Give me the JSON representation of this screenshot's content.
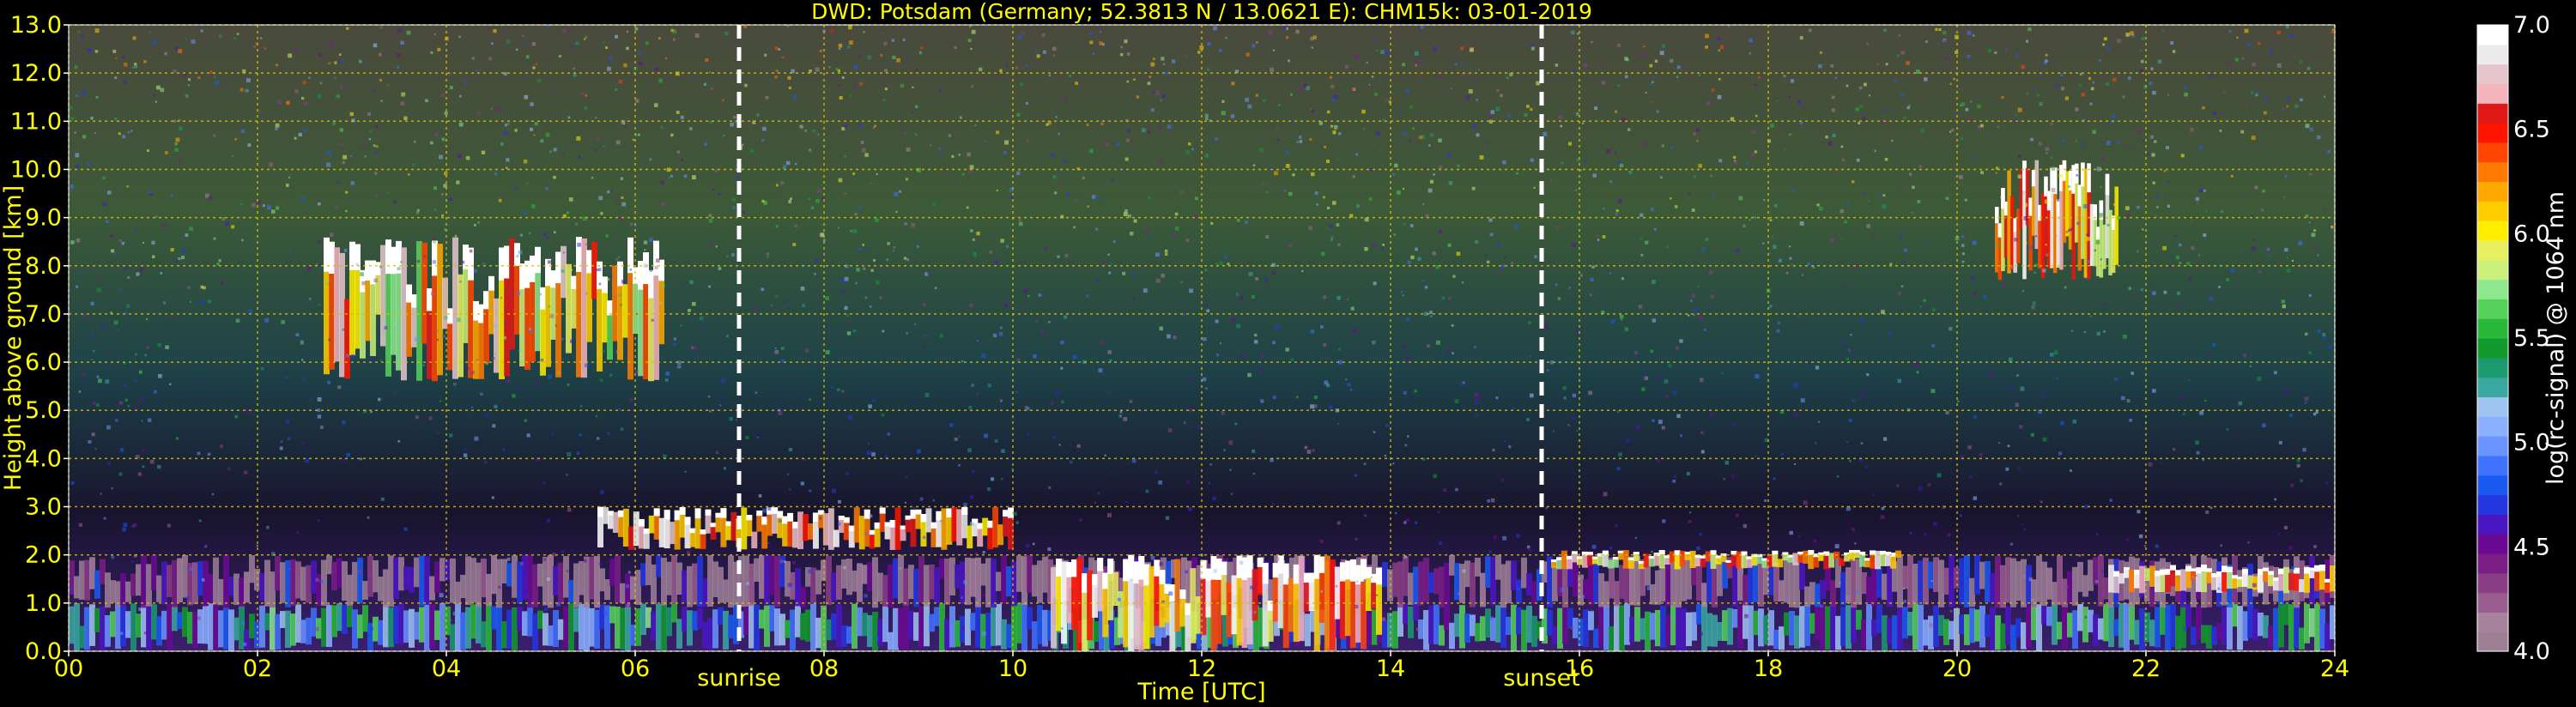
{
  "chart_data": {
    "type": "heatmap",
    "title": "DWD: Potsdam (Germany; 52.3813 N / 13.0621 E):    CHM15k: 03-01-2019",
    "xlabel": "Time [UTC]",
    "ylabel": "Height above ground [km]",
    "xlim": [
      0,
      24
    ],
    "ylim": [
      0,
      13
    ],
    "x_ticks": [
      "00",
      "02",
      "04",
      "06",
      "08",
      "10",
      "12",
      "14",
      "16",
      "18",
      "20",
      "22",
      "24"
    ],
    "y_ticks": [
      "0.0",
      "1.0",
      "2.0",
      "3.0",
      "4.0",
      "5.0",
      "6.0",
      "7.0",
      "8.0",
      "9.0",
      "10.0",
      "11.0",
      "12.0",
      "13.0"
    ],
    "grid": true,
    "markers": [
      {
        "label": "sunrise",
        "time": 7.1
      },
      {
        "label": "sunset",
        "time": 15.6
      }
    ],
    "colorbar": {
      "label": "log(rc-signal) @ 1064 nm",
      "range": [
        4.0,
        7.0
      ],
      "ticks": [
        "4.0",
        "4.5",
        "5.0",
        "5.5",
        "6.0",
        "6.5",
        "7.0"
      ],
      "colors": [
        "#9e7f96",
        "#a8839e",
        "#9a5e8e",
        "#8a3e86",
        "#7a1e86",
        "#6a0a92",
        "#4a16c2",
        "#2436e0",
        "#1a5af0",
        "#3f72ff",
        "#6a94ff",
        "#8bb0ff",
        "#a0c4f0",
        "#3aa8a0",
        "#1a9a6e",
        "#129a2c",
        "#2ab83a",
        "#56d25a",
        "#8ee68e",
        "#c8f07a",
        "#e8f060",
        "#ffee00",
        "#ffcc00",
        "#ffa800",
        "#ff7a00",
        "#ff4600",
        "#ff1400",
        "#e01818",
        "#f4b4bc",
        "#e6c6cc",
        "#ececec",
        "#ffffff"
      ]
    },
    "layers": [
      {
        "name": "background-noise",
        "z": 4.9
      },
      {
        "name": "boundary-layer-mixed",
        "t_start": 0,
        "t_end": 24,
        "h_bottom": 0.0,
        "h_top": 1.0,
        "z": 5.4
      },
      {
        "name": "residual-layer",
        "t_start": 0,
        "t_end": 24,
        "h_bottom": 0.9,
        "h_top": 2.0,
        "z": 4.5
      },
      {
        "name": "cirrus-early",
        "t_start": 2.7,
        "t_end": 6.3,
        "h_bottom": 5.6,
        "h_top": 8.6,
        "z": 6.5
      },
      {
        "name": "cirrus-late",
        "t_start": 20.4,
        "t_end": 21.7,
        "h_bottom": 7.7,
        "h_top": 10.2,
        "z": 6.7
      },
      {
        "name": "stratocumulus-morning",
        "t_start": 5.6,
        "t_end": 10.0,
        "h_bottom": 2.1,
        "h_top": 3.0,
        "z": 6.8
      },
      {
        "name": "precipitation-midday",
        "t_start": 10.4,
        "t_end": 13.9,
        "h_bottom": 0.0,
        "h_top": 2.0,
        "z": 6.7
      },
      {
        "name": "stratocumulus-evening",
        "t_start": 15.7,
        "t_end": 19.4,
        "h_bottom": 1.7,
        "h_top": 2.1,
        "z": 6.6
      },
      {
        "name": "stratocumulus-night",
        "t_start": 21.6,
        "t_end": 24.0,
        "h_bottom": 1.2,
        "h_top": 1.8,
        "z": 6.7
      }
    ]
  }
}
